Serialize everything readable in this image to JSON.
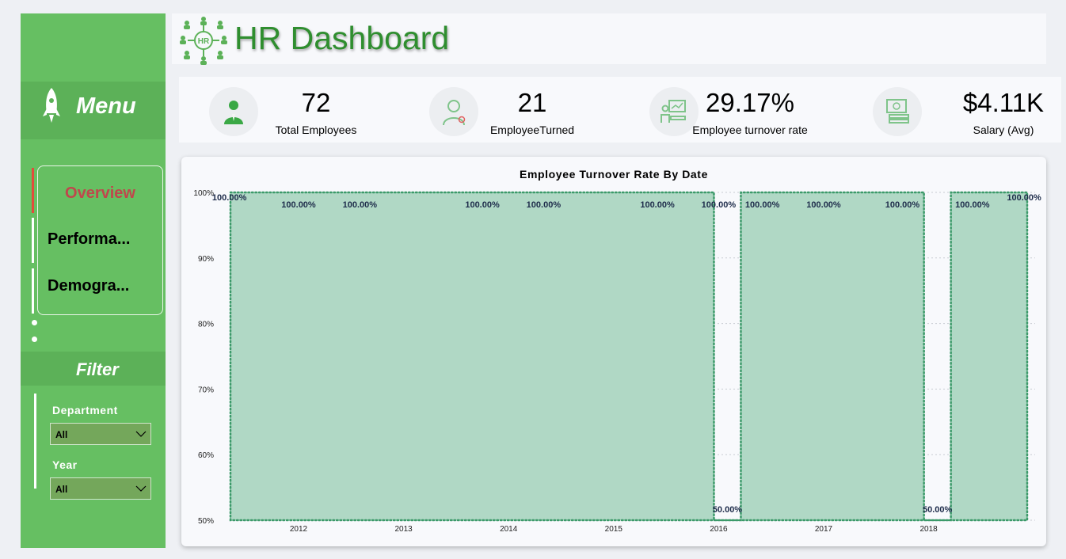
{
  "header": {
    "title": "HR Dashboard",
    "logo_icon": "hr-network-icon"
  },
  "sidebar": {
    "menu_title": "Menu",
    "menu_icon": "rocket-icon",
    "nav": [
      {
        "label": "Overview",
        "active": true
      },
      {
        "label": "Performa..."
      },
      {
        "label": "Demogra..."
      }
    ],
    "filter_title": "Filter",
    "filters": [
      {
        "label": "Department",
        "value": "All"
      },
      {
        "label": "Year",
        "value": "All"
      }
    ]
  },
  "kpis": [
    {
      "value": "72",
      "label": "Total Employees",
      "icon": "employee-icon"
    },
    {
      "value": "21",
      "label": "EmployeeTurned",
      "icon": "doctor-employee-icon"
    },
    {
      "value": "29.17%",
      "label": "Employee turnover rate",
      "icon": "presentation-icon"
    },
    {
      "value": "$4.11K",
      "label": "Salary (Avg)",
      "icon": "money-icon"
    }
  ],
  "colors": {
    "accent": "#66bf62",
    "title_green": "#2f8e2f",
    "area_fill": "#b0d8c5",
    "area_border": "#3c9a6a",
    "active_nav": "#c0474c"
  },
  "chart_data": {
    "type": "area",
    "title": "Employee Turnover Rate By Date",
    "xlabel": "",
    "ylabel": "",
    "x_ticks": [
      "2012",
      "2013",
      "2014",
      "2015",
      "2016",
      "2017",
      "2018"
    ],
    "y_ticks": [
      "100%",
      "90%",
      "80%",
      "70%",
      "60%",
      "50%"
    ],
    "ylim": [
      50,
      100
    ],
    "grid": true,
    "series": [
      {
        "points": [
          {
            "x": "2011-06",
            "y": 100,
            "label": "100.00%"
          },
          {
            "x": "2012-01",
            "y": 100,
            "label": "100.00%"
          },
          {
            "x": "2012-08",
            "y": 100,
            "label": "100.00%"
          },
          {
            "x": "2013-10",
            "y": 100,
            "label": "100.00%"
          },
          {
            "x": "2014-05",
            "y": 100,
            "label": "100.00%"
          },
          {
            "x": "2015-06",
            "y": 100,
            "label": "100.00%"
          },
          {
            "x": "2016-01",
            "y": 100,
            "label": "100.00%"
          },
          {
            "x": "2016-02",
            "y": 50,
            "label": "50.00%"
          },
          {
            "x": "2016-06",
            "y": 100,
            "label": "100.00%"
          },
          {
            "x": "2017-01",
            "y": 100,
            "label": "100.00%"
          },
          {
            "x": "2017-10",
            "y": 100,
            "label": "100.00%"
          },
          {
            "x": "2018-02",
            "y": 50,
            "label": "50.00%"
          },
          {
            "x": "2018-06",
            "y": 100,
            "label": "100.00%"
          },
          {
            "x": "2018-11",
            "y": 100,
            "label": "100.00%"
          }
        ]
      }
    ]
  }
}
